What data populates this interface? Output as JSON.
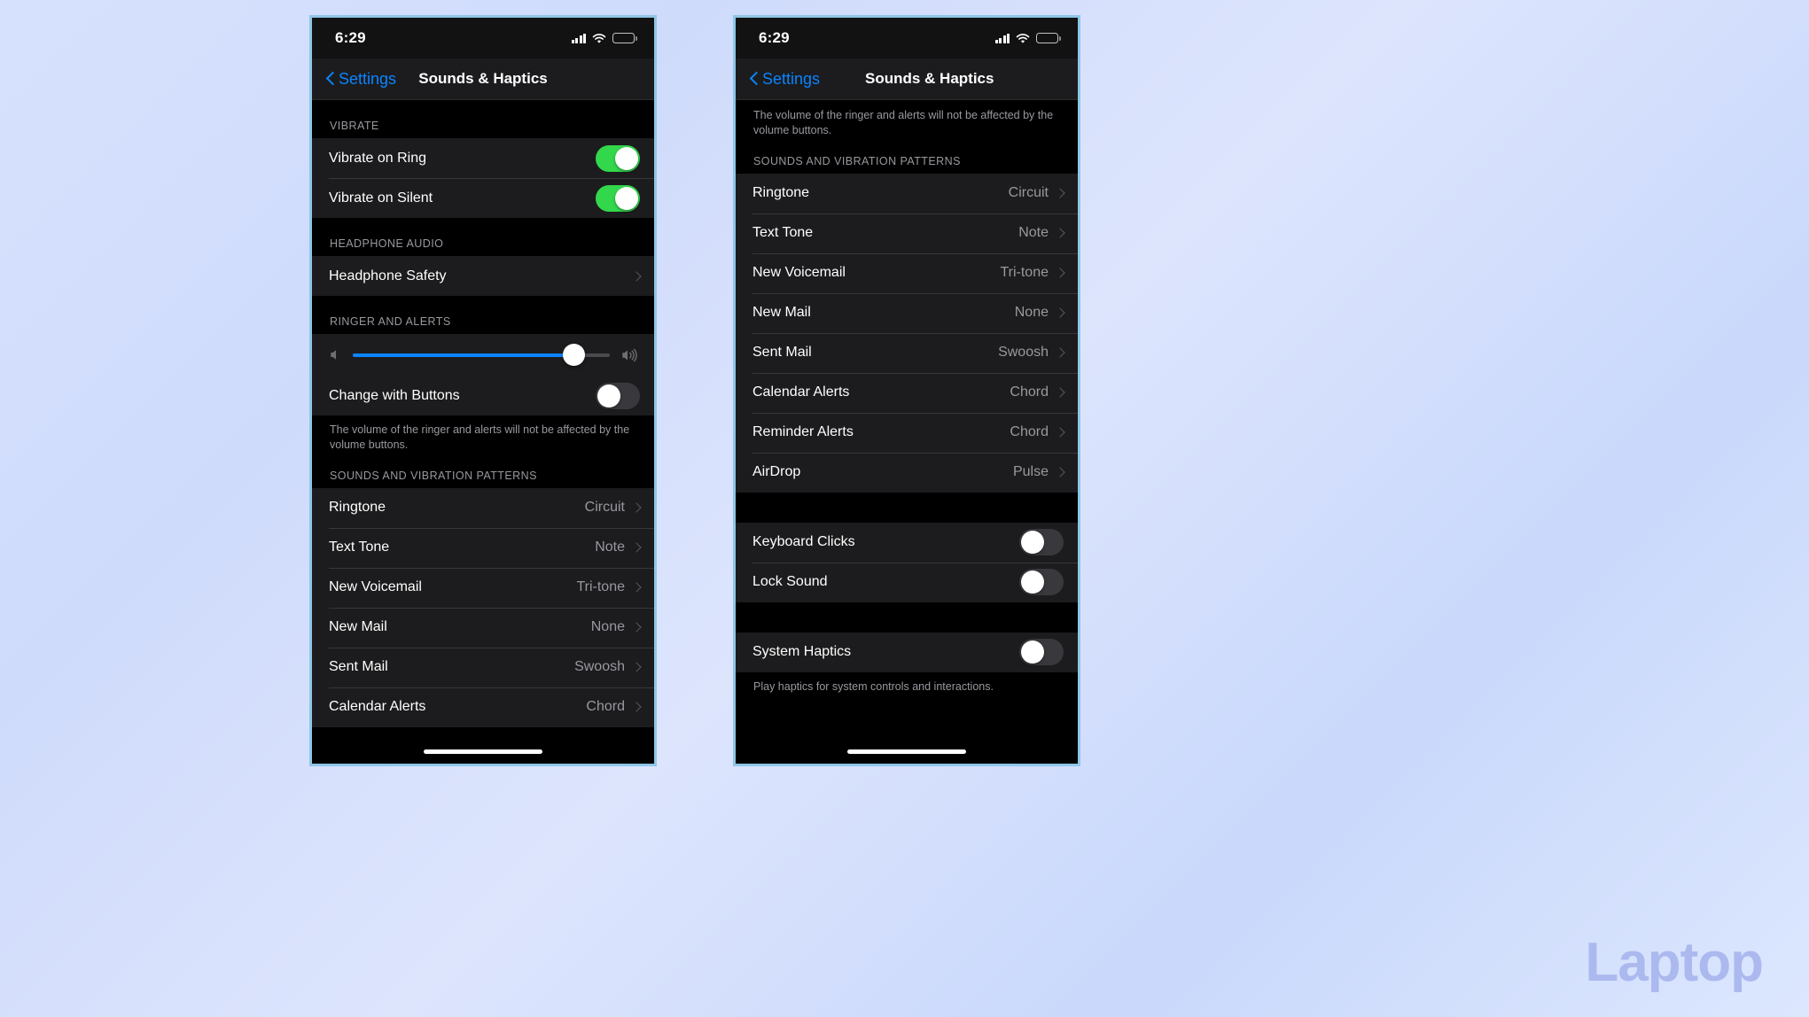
{
  "background": {
    "watermark": "Laptop",
    "watermark_color": "#a9b6ee"
  },
  "colors": {
    "accent_blue": "#0a84ff",
    "toggle_on_green": "#32d74b",
    "toggle_off_gray": "#39393d",
    "row_bg": "#1c1c1e",
    "screen_bg": "#000000",
    "secondary_text": "#98989f"
  },
  "phones": [
    {
      "id": "left",
      "status_bar": {
        "time": "6:29",
        "icons": [
          "cellular-signal-icon",
          "wifi-icon",
          "battery-icon"
        ],
        "battery_level_pct": 72
      },
      "nav": {
        "back_label": "Settings",
        "title": "Sounds & Haptics",
        "back_icon": "chevron-left-icon"
      },
      "sections": [
        {
          "header": "VIBRATE",
          "rows": [
            {
              "label": "Vibrate on Ring",
              "type": "toggle",
              "value": "on"
            },
            {
              "label": "Vibrate on Silent",
              "type": "toggle",
              "value": "on"
            }
          ]
        },
        {
          "header": "HEADPHONE AUDIO",
          "rows": [
            {
              "label": "Headphone Safety",
              "type": "disclosure",
              "value": ""
            }
          ]
        },
        {
          "header": "RINGER AND ALERTS",
          "slider": {
            "value_pct": 86,
            "left_icon": "speaker-low-icon",
            "right_icon": "speaker-high-icon"
          },
          "rows": [
            {
              "label": "Change with Buttons",
              "type": "toggle",
              "value": "off"
            }
          ],
          "footer": "The volume of the ringer and alerts will not be affected by the volume buttons."
        },
        {
          "header": "SOUNDS AND VIBRATION PATTERNS",
          "rows": [
            {
              "label": "Ringtone",
              "type": "disclosure",
              "value": "Circuit"
            },
            {
              "label": "Text Tone",
              "type": "disclosure",
              "value": "Note"
            },
            {
              "label": "New Voicemail",
              "type": "disclosure",
              "value": "Tri-tone"
            },
            {
              "label": "New Mail",
              "type": "disclosure",
              "value": "None"
            },
            {
              "label": "Sent Mail",
              "type": "disclosure",
              "value": "Swoosh"
            },
            {
              "label": "Calendar Alerts",
              "type": "disclosure",
              "value": "Chord"
            }
          ]
        }
      ]
    },
    {
      "id": "right",
      "status_bar": {
        "time": "6:29",
        "icons": [
          "cellular-signal-icon",
          "wifi-icon",
          "battery-icon"
        ],
        "battery_level_pct": 72
      },
      "nav": {
        "back_label": "Settings",
        "title": "Sounds & Haptics",
        "back_icon": "chevron-left-icon"
      },
      "top_footer": "The volume of the ringer and alerts will not be affected by the volume buttons.",
      "sections": [
        {
          "header": "SOUNDS AND VIBRATION PATTERNS",
          "rows": [
            {
              "label": "Ringtone",
              "type": "disclosure",
              "value": "Circuit"
            },
            {
              "label": "Text Tone",
              "type": "disclosure",
              "value": "Note"
            },
            {
              "label": "New Voicemail",
              "type": "disclosure",
              "value": "Tri-tone"
            },
            {
              "label": "New Mail",
              "type": "disclosure",
              "value": "None"
            },
            {
              "label": "Sent Mail",
              "type": "disclosure",
              "value": "Swoosh"
            },
            {
              "label": "Calendar Alerts",
              "type": "disclosure",
              "value": "Chord"
            },
            {
              "label": "Reminder Alerts",
              "type": "disclosure",
              "value": "Chord"
            },
            {
              "label": "AirDrop",
              "type": "disclosure",
              "value": "Pulse"
            }
          ]
        },
        {
          "header": "",
          "rows": [
            {
              "label": "Keyboard Clicks",
              "type": "toggle",
              "value": "off"
            },
            {
              "label": "Lock Sound",
              "type": "toggle",
              "value": "off"
            }
          ]
        },
        {
          "header": "",
          "rows": [
            {
              "label": "System Haptics",
              "type": "toggle",
              "value": "off"
            }
          ],
          "footer": "Play haptics for system controls and interactions."
        }
      ]
    }
  ]
}
